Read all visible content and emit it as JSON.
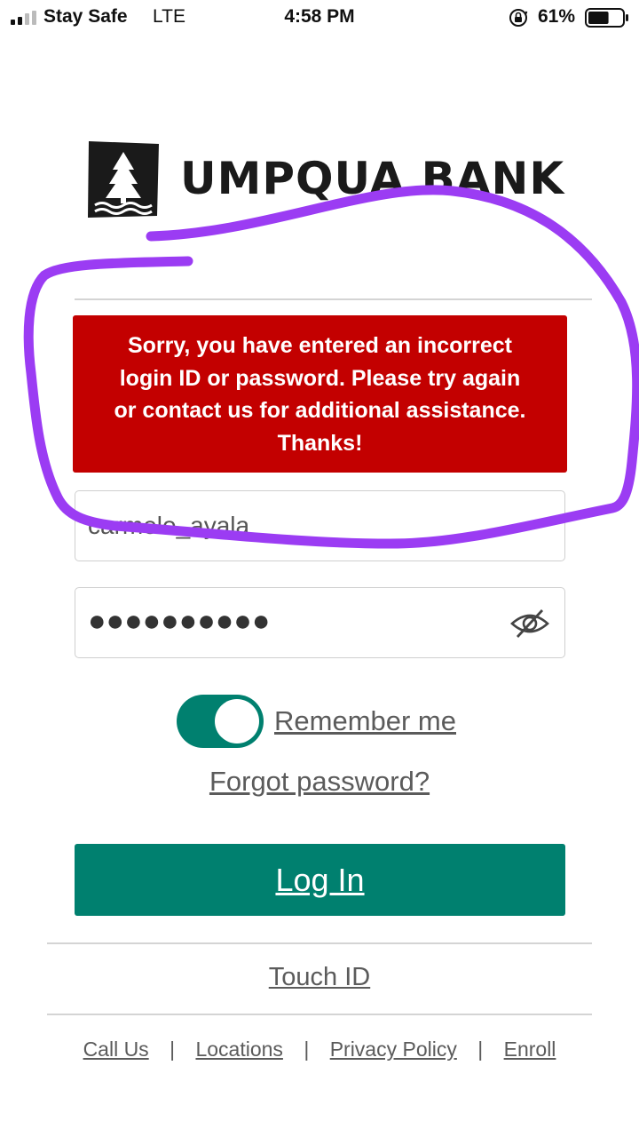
{
  "status_bar": {
    "carrier": "Stay Safe",
    "network": "LTE",
    "time": "4:58 PM",
    "battery": "61%",
    "battery_level": 0.61,
    "icons": [
      "cellular-signal-icon",
      "rotation-lock-icon",
      "battery-icon"
    ]
  },
  "brand": {
    "name": "UMPQUA BANK",
    "logo_icon": "tree-logo-icon"
  },
  "error": {
    "lines": [
      "Sorry, you have entered an incorrect",
      "login ID or password.  Please try again",
      "or contact us for additional assistance.",
      "Thanks!"
    ]
  },
  "form": {
    "username_value": "carmelo_ayala",
    "password_masked": "●●●●●●●●●●",
    "password_toggle_icon": "eye-slash-icon",
    "remember_label": "Remember me",
    "remember_on": true,
    "forgot_label": "Forgot password?",
    "login_label": "Log In",
    "touch_id_label": "Touch ID"
  },
  "footer": {
    "links": [
      "Call Us",
      "Locations",
      "Privacy Policy",
      "Enroll"
    ],
    "separator": "|"
  },
  "colors": {
    "accent": "#00806f",
    "error": "#c30000",
    "annotation": "#9b3cf3"
  }
}
